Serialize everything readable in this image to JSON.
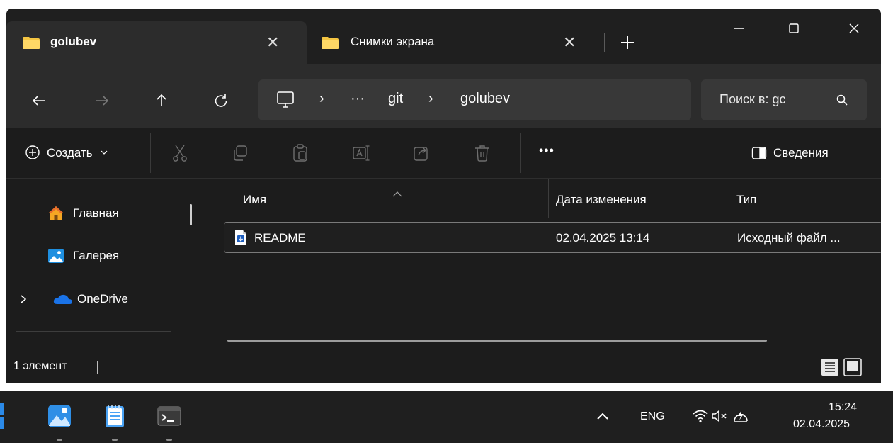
{
  "tabs": [
    {
      "label": "golubev",
      "close": "✕",
      "active": true
    },
    {
      "label": "Снимки экрана",
      "close": "✕",
      "active": false
    }
  ],
  "breadcrumb": {
    "overflow": "···",
    "items": [
      "git",
      "golubev"
    ],
    "separator": "›"
  },
  "search": {
    "placeholder": "Поиск в: gc"
  },
  "commandbar": {
    "create_label": "Создать",
    "more_label": "•••",
    "details_label": "Сведения"
  },
  "navpane": {
    "items": [
      {
        "label": "Главная",
        "icon": "home-icon"
      },
      {
        "label": "Галерея",
        "icon": "gallery-icon"
      },
      {
        "label": "OneDrive",
        "icon": "onedrive-icon"
      }
    ]
  },
  "filelist": {
    "columns": [
      "Имя",
      "Дата изменения",
      "Тип"
    ],
    "rows": [
      {
        "name": "README",
        "modified": "02.04.2025 13:14",
        "type": "Исходный файл ..."
      }
    ]
  },
  "statusbar": {
    "count": "1 элемент"
  },
  "tray": {
    "language": "ENG",
    "time": "15:24",
    "date": "02.04.2025"
  },
  "colors": {
    "window_bg": "#1c1c1c",
    "tab_active": "#2c2c2c",
    "address_bg": "#383838",
    "folder_yellow": "#f4c542"
  }
}
